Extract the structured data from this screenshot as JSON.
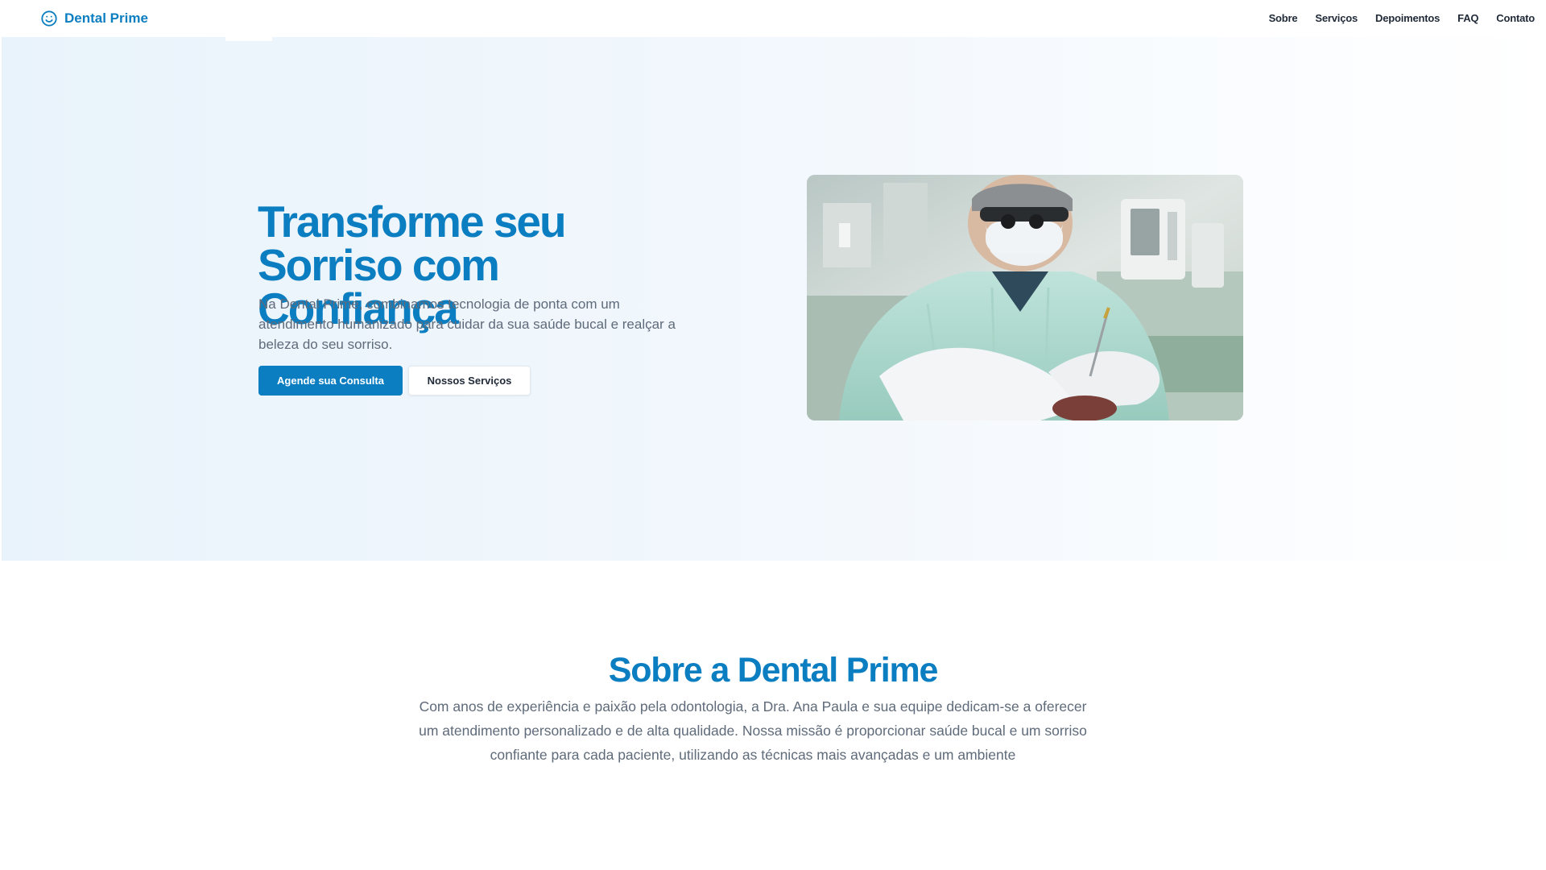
{
  "header": {
    "brand": "Dental Prime",
    "logo_icon": "smile-icon",
    "nav": [
      "Sobre",
      "Serviços",
      "Depoimentos",
      "FAQ",
      "Contato"
    ]
  },
  "hero": {
    "title": "Transforme seu Sorriso com Confiança",
    "description": "Na Dental Prime, combinamos tecnologia de ponta com um atendimento humanizado para cuidar da sua saúde bucal e realçar a beleza do seu sorriso.",
    "primary_button": "Agende sua Consulta",
    "secondary_button": "Nossos Serviços"
  },
  "about": {
    "title": "Sobre a Dental Prime",
    "text": "Com anos de experiência e paixão pela odontologia, a Dra. Ana Paula e sua equipe dedicam-se a oferecer um atendimento personalizado e de alta qualidade. Nossa missão é proporcionar saúde bucal e um sorriso confiante para cada paciente, utilizando as técnicas mais avançadas e um ambiente"
  },
  "colors": {
    "brand": "#0b7ec1",
    "text_muted": "#5f6b7a",
    "hero_bg": "#e9f3fb"
  }
}
